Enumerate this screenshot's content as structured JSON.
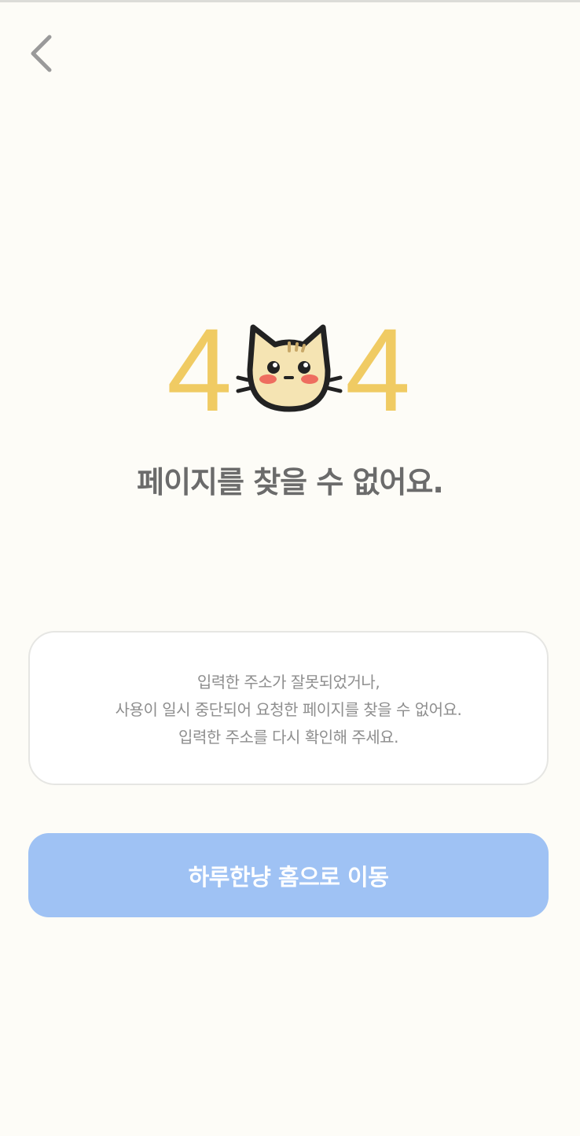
{
  "nav": {
    "back_icon": "chevron-left-icon"
  },
  "hero": {
    "digit_left": "4",
    "digit_right": "4",
    "mascot_icon": "cat-face-icon"
  },
  "headline": "페이지를 찾을 수 없어요.",
  "message": {
    "lines": [
      "입력한 주소가 잘못되었거나,",
      "사용이 일시 중단되어 요청한 페이지를 찾을 수 없어요.",
      "입력한 주소를 다시 확인해 주세요."
    ]
  },
  "home_button": {
    "label": "하루한냥 홈으로 이동"
  },
  "colors": {
    "background": "#fdfcf7",
    "digit": "#f0cb63",
    "headline": "#6b6b6b",
    "message": "#8e8e8e",
    "button": "#9fc2f4",
    "cat_fill": "#f5e4b3",
    "cat_cheek": "#ee6d5f"
  }
}
